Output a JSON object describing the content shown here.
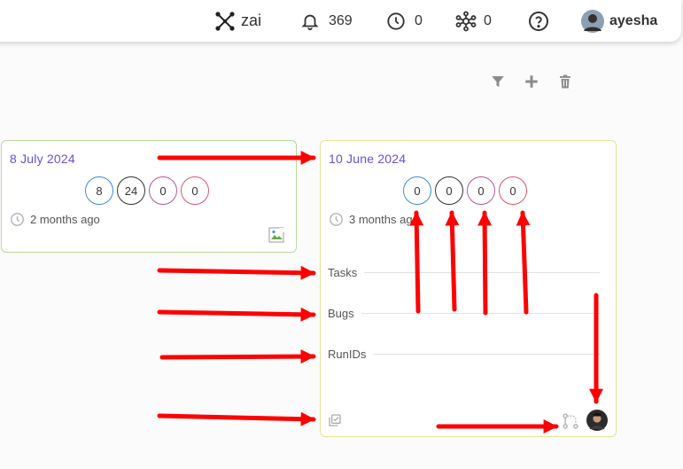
{
  "header": {
    "workspace_name": "zai",
    "notifications_count": "369",
    "clock_count": "0",
    "network_count": "0",
    "user_name": "ayesha"
  },
  "colors": {
    "accent": "#6a4fd8",
    "arrow": "#ff0000",
    "badge_blue": "#3a8de0",
    "badge_dark": "#333333",
    "badge_purple": "#b4569c",
    "badge_red": "#e0556a",
    "card_left_border": "#b6d89b",
    "card_right_border": "#e3e494"
  },
  "cards": [
    {
      "date": "8 July 2024",
      "counts": [
        "8",
        "24",
        "0",
        "0"
      ],
      "time_ago": "2 months ago"
    },
    {
      "date": "10 June 2024",
      "counts": [
        "0",
        "0",
        "0",
        "0"
      ],
      "time_ago": "3 months ago",
      "sections": {
        "tasks": "Tasks",
        "bugs": "Bugs",
        "runids": "RunIDs"
      }
    }
  ]
}
